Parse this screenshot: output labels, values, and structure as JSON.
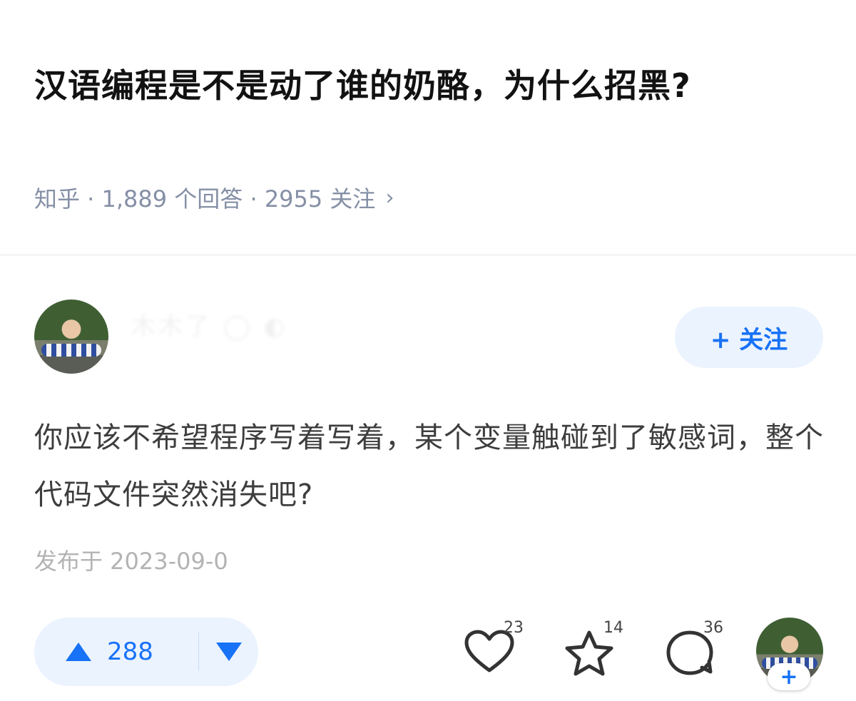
{
  "question": {
    "title": "汉语编程是不是动了谁的奶酪，为什么招黑?",
    "meta": "知乎 · 1,889 个回答 · 2955 关注",
    "chevron": "›"
  },
  "author": {
    "name": "木木了 ◯ ◐",
    "follow_label": "+ 关注"
  },
  "answer": {
    "text": "你应该不希望程序写着写着，某个变量触碰到了敏感词，整个代码文件突然消失吧?",
    "published": "发布于 2023-09-0"
  },
  "actions": {
    "upvote_count": "288",
    "like_count": "23",
    "favorite_count": "14",
    "comment_count": "36",
    "follow_plus": "+"
  },
  "colors": {
    "accent": "#1772f6",
    "pill_bg": "#ebf3ff",
    "meta_gray": "#8590a6"
  }
}
